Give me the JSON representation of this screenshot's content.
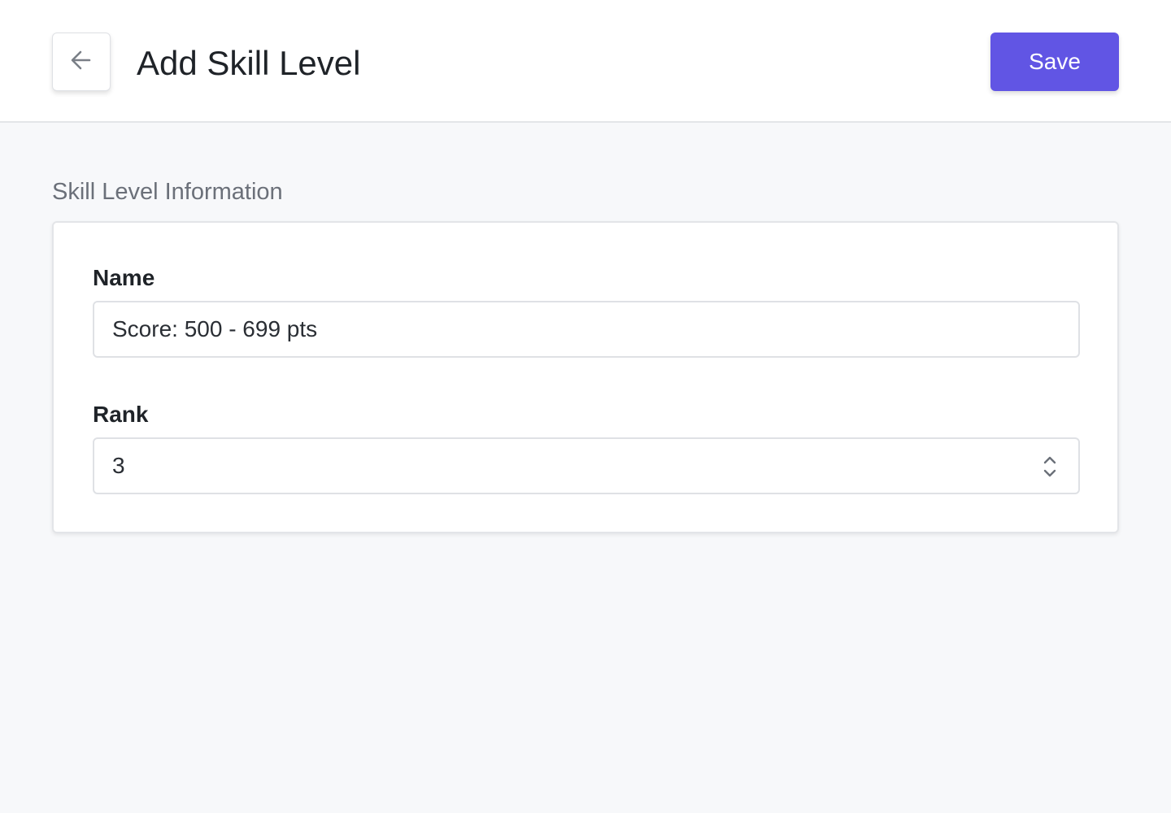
{
  "header": {
    "title": "Add Skill Level",
    "back_icon": "arrow-left-icon",
    "save_label": "Save"
  },
  "section": {
    "title": "Skill Level Information"
  },
  "form": {
    "name": {
      "label": "Name",
      "value": "Score: 500 - 699 pts"
    },
    "rank": {
      "label": "Rank",
      "value": "3",
      "stepper_icon": "chevron-up-down-icon"
    }
  },
  "colors": {
    "accent": "#6155e4",
    "background": "#f7f8fa",
    "card": "#ffffff",
    "border": "#dfe1e5"
  }
}
